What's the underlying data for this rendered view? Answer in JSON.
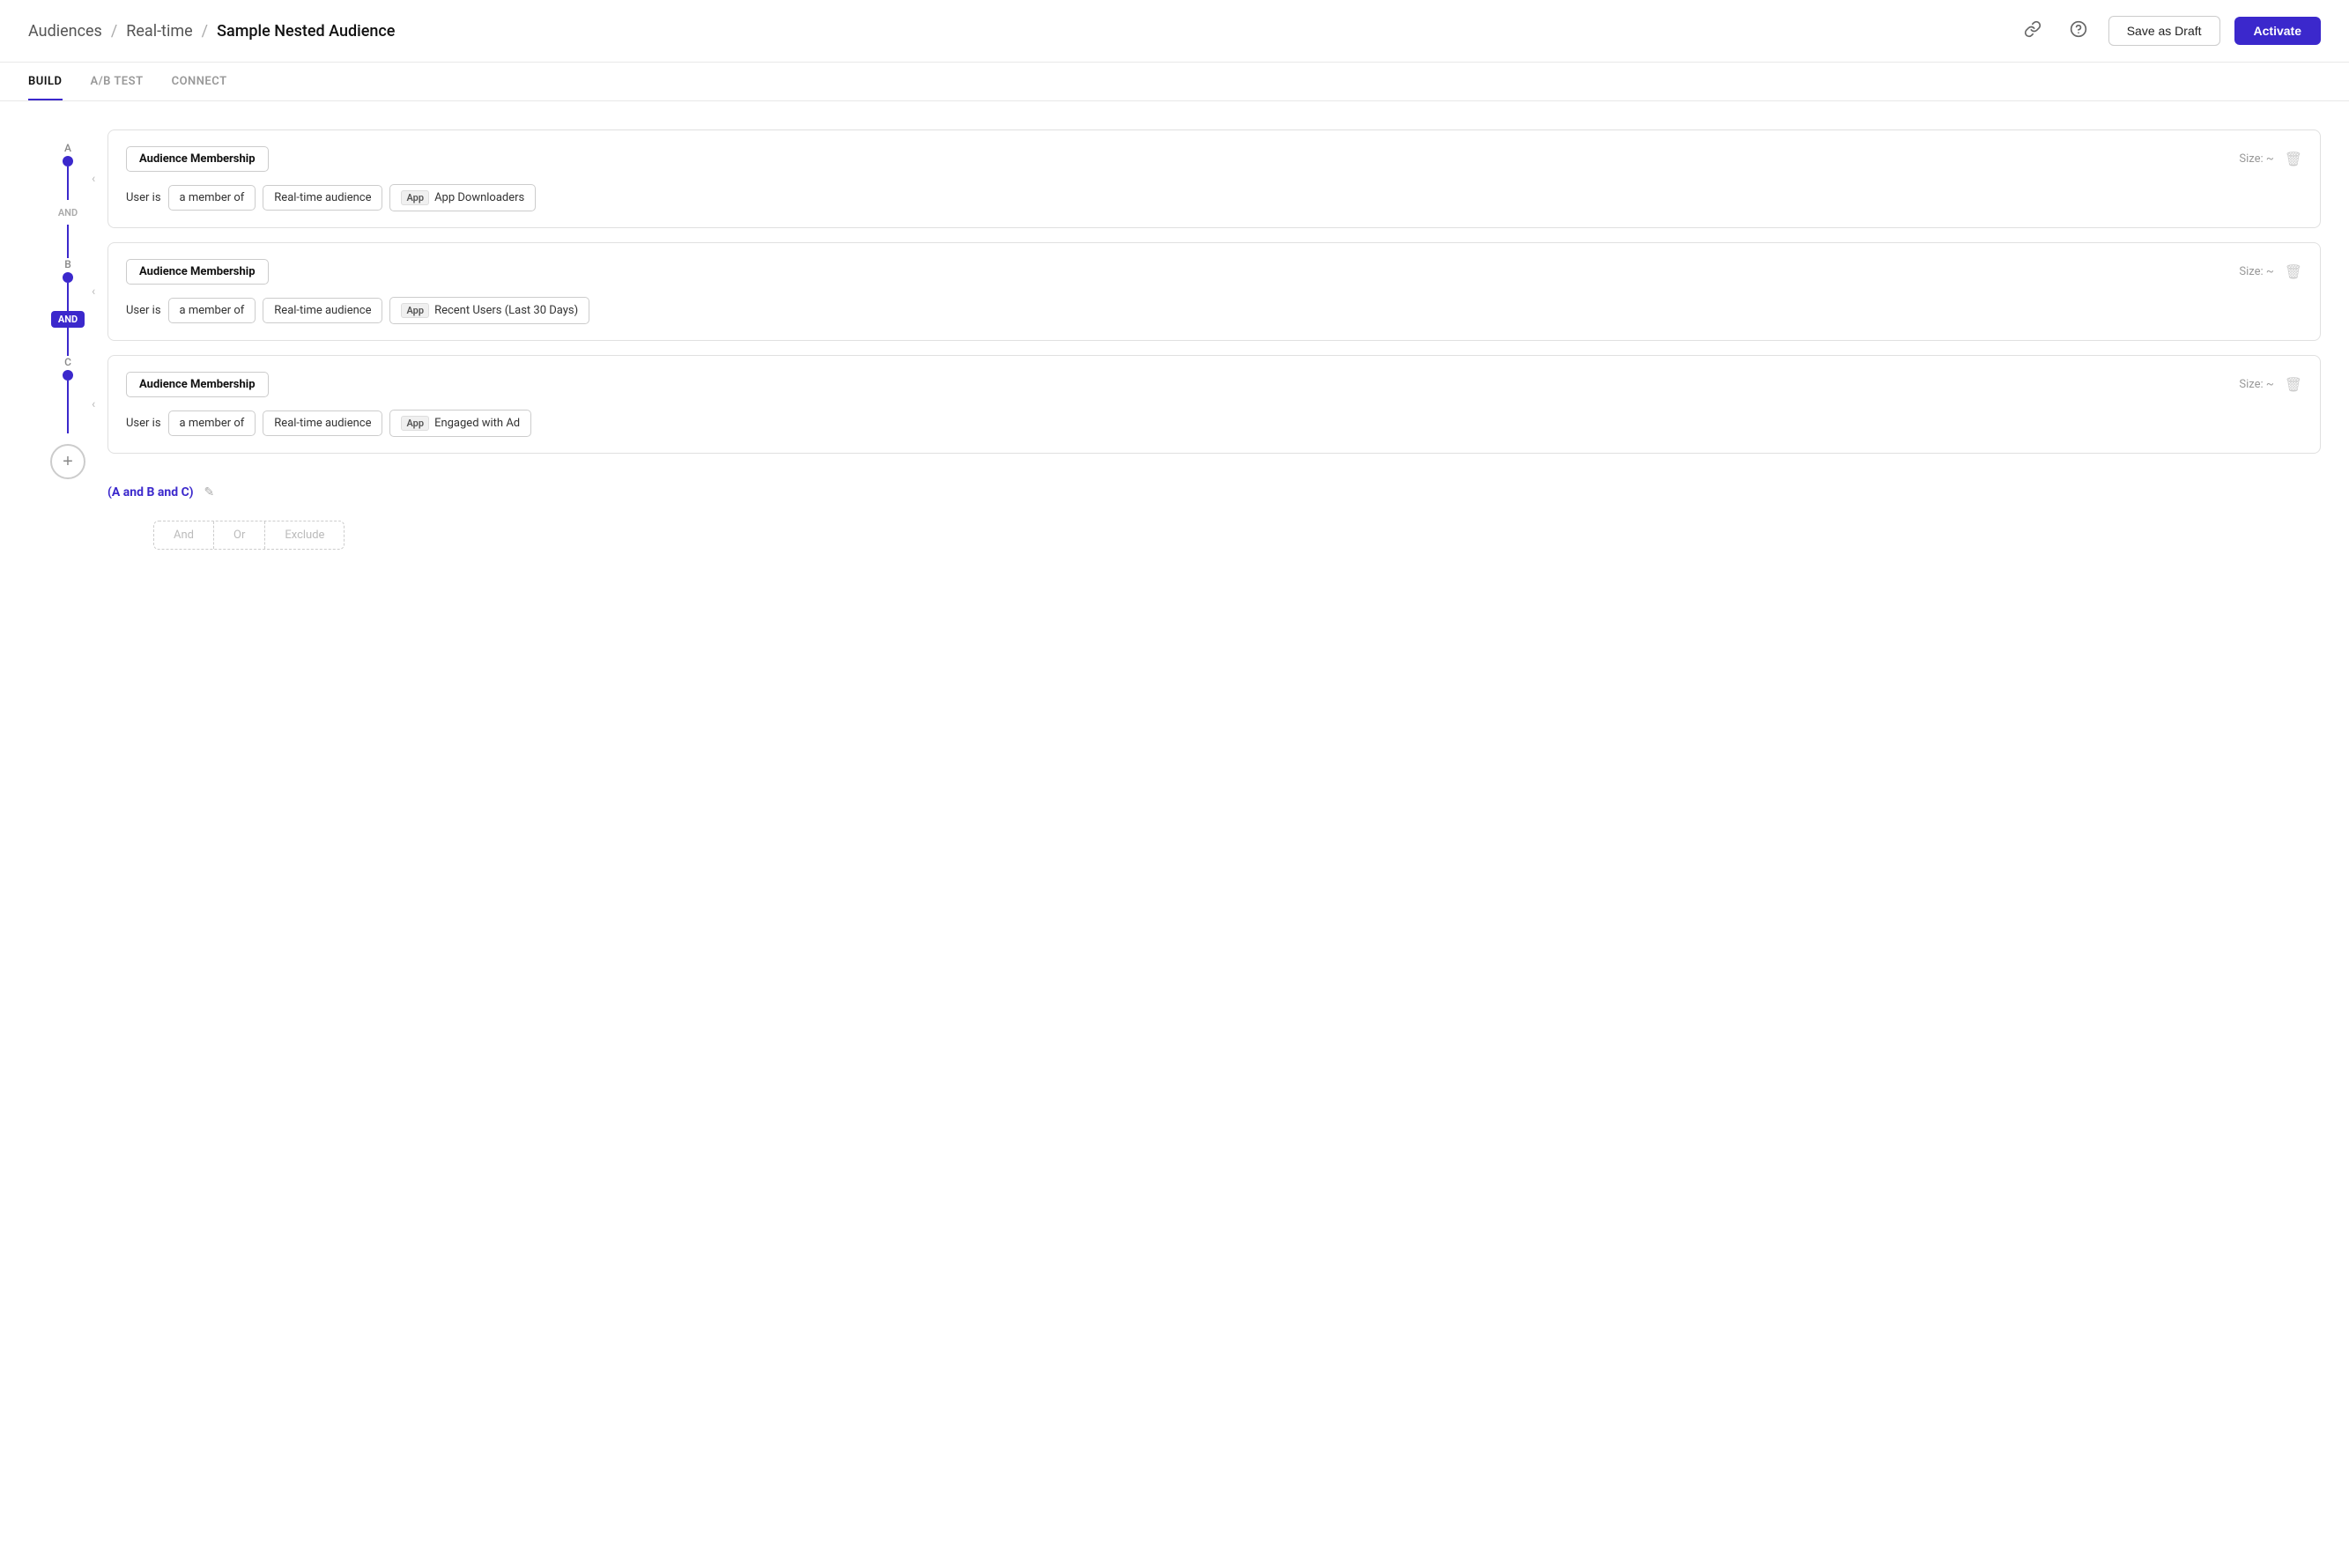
{
  "header": {
    "breadcrumb": [
      {
        "label": "Audiences",
        "active": false
      },
      {
        "label": "Real-time",
        "active": false
      },
      {
        "label": "Sample Nested Audience",
        "active": true
      }
    ],
    "save_draft_label": "Save as Draft",
    "activate_label": "Activate"
  },
  "tabs": [
    {
      "label": "BUILD",
      "active": true
    },
    {
      "label": "A/B TEST",
      "active": false
    },
    {
      "label": "CONNECT",
      "active": false
    }
  ],
  "blocks": [
    {
      "node_label": "A",
      "title": "Audience Membership",
      "size_label": "Size: ~",
      "user_is": "User is",
      "member_of": "a member of",
      "audience_type": "Real-time audience",
      "app_label": "App",
      "audience_name": "App Downloaders"
    },
    {
      "node_label": "B",
      "title": "Audience Membership",
      "size_label": "Size: ~",
      "user_is": "User is",
      "member_of": "a member of",
      "audience_type": "Real-time audience",
      "app_label": "App",
      "audience_name": "Recent Users (Last 30 Days)"
    },
    {
      "node_label": "C",
      "title": "Audience Membership",
      "size_label": "Size: ~",
      "user_is": "User is",
      "member_of": "a member of",
      "audience_type": "Real-time audience",
      "app_label": "App",
      "audience_name": "Engaged with Ad"
    }
  ],
  "and_label": "AND",
  "logic_expression": "(A and B and C)",
  "add_options": [
    "And",
    "Or",
    "Exclude"
  ]
}
